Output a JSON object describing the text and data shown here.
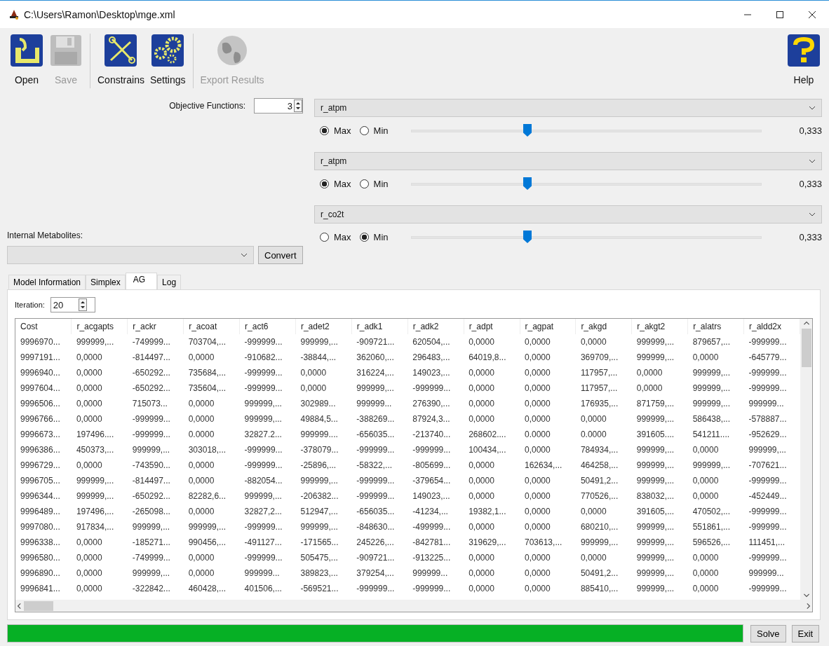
{
  "window": {
    "title": "C:\\Users\\Ramon\\Desktop\\mge.xml"
  },
  "toolbar": {
    "groups": [
      [
        {
          "kind": "open",
          "label": "Open",
          "disabled": false
        },
        {
          "kind": "save",
          "label": "Save",
          "disabled": true
        }
      ],
      [
        {
          "kind": "constrains",
          "label": "Constrains",
          "disabled": false
        },
        {
          "kind": "settings",
          "label": "Settings",
          "disabled": false
        }
      ],
      [
        {
          "kind": "export",
          "label": "Export Results",
          "disabled": true
        }
      ]
    ],
    "help": {
      "kind": "help",
      "label": "Help",
      "disabled": false
    }
  },
  "objective_functions": {
    "label": "Objective Functions:",
    "value": "3"
  },
  "objectives": [
    {
      "reaction": "r_atpm",
      "options": [
        {
          "label": "Max",
          "selected": true
        },
        {
          "label": "Min",
          "selected": false
        }
      ],
      "level": 0.333,
      "reading": "0,333"
    },
    {
      "reaction": "r_atpm",
      "options": [
        {
          "label": "Max",
          "selected": true
        },
        {
          "label": "Min",
          "selected": false
        }
      ],
      "level": 0.333,
      "reading": "0,333"
    },
    {
      "reaction": "r_co2t",
      "options": [
        {
          "label": "Max",
          "selected": false
        },
        {
          "label": "Min",
          "selected": true
        }
      ],
      "level": 0.333,
      "reading": "0,333"
    }
  ],
  "internal_metabolites": {
    "label": "Internal Metabolites:",
    "button": "Convert"
  },
  "tabs": [
    {
      "label": "Model Information",
      "selected": false
    },
    {
      "label": "Simplex",
      "selected": false
    },
    {
      "label": "AG",
      "selected": true
    },
    {
      "label": "Log",
      "selected": false
    }
  ],
  "iteration": {
    "label": "Iteration:",
    "value": "20"
  },
  "table": {
    "columns": [
      "Cost",
      "r_acgapts",
      "r_ackr",
      "r_acoat",
      "r_act6",
      "r_adet2",
      "r_adk1",
      "r_adk2",
      "r_adpt",
      "r_agpat",
      "r_akgd",
      "r_akgt2",
      "r_alatrs",
      "r_aldd2x"
    ],
    "rows": [
      [
        "9996970...",
        "999999,...",
        "-749999...",
        "703704,...",
        "-999999...",
        "999999,...",
        "-909721...",
        "620504,...",
        "0,0000",
        "0,0000",
        "0,0000",
        "999999,...",
        "879657,...",
        "-999999..."
      ],
      [
        "9997191...",
        "0,0000",
        "-814497...",
        "0,0000",
        "-910682...",
        "-38844,...",
        "362060,...",
        "296483,...",
        "64019,8...",
        "0,0000",
        "369709,...",
        "999999,...",
        "0,0000",
        "-645779..."
      ],
      [
        "9996940...",
        "0,0000",
        "-650292...",
        "735684,...",
        "-999999...",
        "0,0000",
        "316224,...",
        "149023,...",
        "0,0000",
        "0,0000",
        "117957,...",
        "0,0000",
        "999999,...",
        "-999999..."
      ],
      [
        "9997604...",
        "0,0000",
        "-650292...",
        "735604,...",
        "-999999...",
        "0,0000",
        "999999,...",
        "-999999...",
        "0,0000",
        "0,0000",
        "117957,...",
        "0,0000",
        "999999,...",
        "-999999..."
      ],
      [
        "9996506...",
        "0,0000",
        "715073...",
        "0,0000",
        "999999,...",
        "302989...",
        "999999...",
        "276390,...",
        "0,0000",
        "0,0000",
        "176935,...",
        "871759,...",
        "999999,...",
        "999999..."
      ],
      [
        "9996766...",
        "0,0000",
        "-999999...",
        "0,0000",
        "999999,...",
        "49884,5...",
        "-388269...",
        "87924,3...",
        "0,0000",
        "0,0000",
        "0,0000",
        "999999,...",
        "586438,...",
        "-578887..."
      ],
      [
        "9996673...",
        "197496....",
        "-999999...",
        "0.0000",
        "32827.2...",
        "999999....",
        "-656035...",
        "-213740...",
        "268602....",
        "0.0000",
        "0.0000",
        "391605....",
        "541211....",
        "-952629..."
      ],
      [
        "9996386...",
        "450373,...",
        "999999,...",
        "303018,...",
        "-999999...",
        "-378079...",
        "-999999...",
        "-999999...",
        "100434,...",
        "0,0000",
        "784934,...",
        "999999,...",
        "0,0000",
        "999999,..."
      ],
      [
        "9996729...",
        "0,0000",
        "-743590...",
        "0,0000",
        "-999999...",
        "-25896,...",
        "-58322,...",
        "-805699...",
        "0,0000",
        "162634,...",
        "464258,...",
        "999999,...",
        "999999,...",
        "-707621..."
      ],
      [
        "9996705...",
        "999999,...",
        "-814497...",
        "0,0000",
        "-882054...",
        "999999,...",
        "-999999...",
        "-379654...",
        "0,0000",
        "0,0000",
        "50491,2...",
        "999999,...",
        "0,0000",
        "-999999..."
      ],
      [
        "9996344...",
        "999999,...",
        "-650292...",
        "82282,6...",
        "999999,...",
        "-206382...",
        "-999999...",
        "149023,...",
        "0,0000",
        "0,0000",
        "770526,...",
        "838032,...",
        "0,0000",
        "-452449..."
      ],
      [
        "9996489...",
        "197496,...",
        "-265098...",
        "0,0000",
        "32827,2...",
        "512947,...",
        "-656035...",
        "-41234,...",
        "19382,1...",
        "0,0000",
        "0,0000",
        "391605,...",
        "470502,...",
        "-999999..."
      ],
      [
        "9997080...",
        "917834,...",
        "999999,...",
        "999999,...",
        "-999999...",
        "999999,...",
        "-848630...",
        "-499999...",
        "0,0000",
        "0,0000",
        "680210,...",
        "999999,...",
        "551861,...",
        "-999999..."
      ],
      [
        "9996338...",
        "0,0000",
        "-185271...",
        "990456,...",
        "-491127...",
        "-171565...",
        "245226,...",
        "-842781...",
        "319629,...",
        "703613,...",
        "999999,...",
        "999999,...",
        "596526,...",
        "111451,..."
      ],
      [
        "9996580...",
        "0,0000",
        "-749999...",
        "0,0000",
        "-999999...",
        "505475,...",
        "-909721...",
        "-913225...",
        "0,0000",
        "0,0000",
        "0,0000",
        "999999,...",
        "0,0000",
        "-999999..."
      ],
      [
        "9996890...",
        "0,0000",
        "999999,...",
        "0,0000",
        "999999...",
        "389823,...",
        "379254,...",
        "999999...",
        "0,0000",
        "0,0000",
        "50491,2...",
        "999999,...",
        "0,0000",
        "999999..."
      ],
      [
        "9996841...",
        "0,0000",
        "-322842...",
        "460428,...",
        "401506,...",
        "-569521...",
        "-999999...",
        "-999999...",
        "0,0000",
        "0,0000",
        "885410,...",
        "999999,...",
        "0,0000",
        "-999999..."
      ]
    ]
  },
  "progress": {
    "level": 1
  },
  "buttons": [
    "Solve",
    "Exit"
  ]
}
